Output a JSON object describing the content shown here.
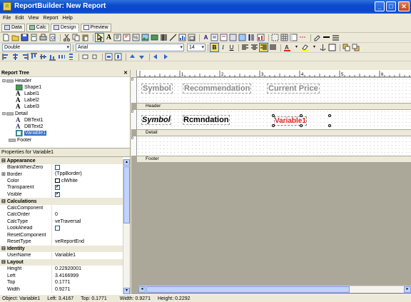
{
  "window": {
    "title": "ReportBuilder: New Report",
    "app_icon_label": "R"
  },
  "menu": [
    "File",
    "Edit",
    "View",
    "Report",
    "Help"
  ],
  "tabs": [
    {
      "label": "Data",
      "active": false
    },
    {
      "label": "Calc",
      "active": false
    },
    {
      "label": "Design",
      "active": true
    },
    {
      "label": "Preview",
      "active": false
    }
  ],
  "format_toolbar": {
    "border_style": "Double",
    "font_name": "Arial",
    "font_size": "14",
    "bold": "B",
    "italic": "I",
    "underline": "U"
  },
  "report_tree": {
    "title": "Report Tree",
    "items": [
      {
        "label": "Header",
        "level": 0,
        "icon": "band-icon"
      },
      {
        "label": "Shape1",
        "level": 1,
        "icon": "shape-icon"
      },
      {
        "label": "Label1",
        "level": 1,
        "icon": "label-icon"
      },
      {
        "label": "Label2",
        "level": 1,
        "icon": "label-icon"
      },
      {
        "label": "Label3",
        "level": 1,
        "icon": "label-icon"
      },
      {
        "label": "Detail",
        "level": 0,
        "icon": "band-icon"
      },
      {
        "label": "DBText1",
        "level": 1,
        "icon": "dbtext-icon"
      },
      {
        "label": "DBText2",
        "level": 1,
        "icon": "dbtext-icon"
      },
      {
        "label": "Variable1",
        "level": 1,
        "icon": "variable-icon",
        "selected": true
      },
      {
        "label": "Footer",
        "level": 0,
        "icon": "band-icon"
      }
    ]
  },
  "properties": {
    "title": "Properties for Variable1",
    "rows": [
      {
        "cat": true,
        "name": "Appearance"
      },
      {
        "name": "BlankWhenZero",
        "value": "",
        "check": "unchecked"
      },
      {
        "name": "Border",
        "value": "(TppBorder)",
        "expand": true
      },
      {
        "name": "Color",
        "value": "clWhite",
        "swatch": "#ffffff"
      },
      {
        "name": "Transparent",
        "value": "",
        "check": "checked"
      },
      {
        "name": "Visible",
        "value": "",
        "check": "checked"
      },
      {
        "cat": true,
        "name": "Calculations"
      },
      {
        "name": "CalcComponent",
        "value": ""
      },
      {
        "name": "CalcOrder",
        "value": "0"
      },
      {
        "name": "CalcType",
        "value": "veTraversal"
      },
      {
        "name": "LookAhead",
        "value": "",
        "check": "unchecked"
      },
      {
        "name": "ResetComponent",
        "value": ""
      },
      {
        "name": "ResetType",
        "value": "veReportEnd"
      },
      {
        "cat": true,
        "name": "Identity"
      },
      {
        "name": "UserName",
        "value": "Variable1"
      },
      {
        "cat": true,
        "name": "Layout"
      },
      {
        "name": "Height",
        "value": "0.22920001"
      },
      {
        "name": "Left",
        "value": "3.4166999"
      },
      {
        "name": "Top",
        "value": "0.1771"
      },
      {
        "name": "Width",
        "value": "0.9271"
      }
    ]
  },
  "designer": {
    "ruler_numbers": [
      "1",
      "2",
      "3",
      "4",
      "5",
      "6"
    ],
    "header_labels": [
      "Symbol",
      "Recommendation",
      "Current Price"
    ],
    "detail_fields": [
      "Symbol",
      "Rcmndation",
      "Variable1"
    ],
    "band_names": [
      "Header",
      "Detail",
      "Footer"
    ],
    "vruler_number": "0",
    "variable_color": "#e02020"
  },
  "status": {
    "object": "Object: Variable1",
    "left": "Left: 3.4167",
    "top": "Top: 0.1771",
    "width": "Width: 0.9271",
    "height": "Height: 0.2292"
  }
}
